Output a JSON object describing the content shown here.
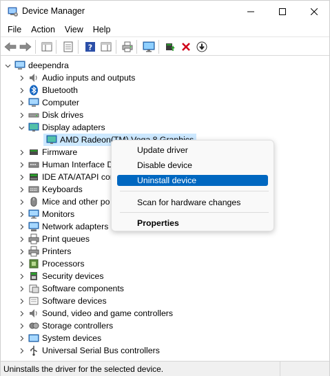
{
  "window": {
    "title": "Device Manager"
  },
  "menu": [
    "File",
    "Action",
    "View",
    "Help"
  ],
  "tree": {
    "root": "deependra",
    "items": [
      "Audio inputs and outputs",
      "Bluetooth",
      "Computer",
      "Disk drives",
      "Display adapters",
      "AMD Radeon(TM) Vega 8 Graphics",
      "Firmware",
      "Human Interface D",
      "IDE ATA/ATAPI cor",
      "Keyboards",
      "Mice and other po",
      "Monitors",
      "Network adapters",
      "Print queues",
      "Printers",
      "Processors",
      "Security devices",
      "Software components",
      "Software devices",
      "Sound, video and game controllers",
      "Storage controllers",
      "System devices",
      "Universal Serial Bus controllers"
    ]
  },
  "context_menu": {
    "items": [
      "Update driver",
      "Disable device",
      "Uninstall device",
      "Scan for hardware changes",
      "Properties"
    ],
    "highlighted": "Uninstall device"
  },
  "status": "Uninstalls the driver for the selected device.",
  "colors": {
    "highlight": "#0067c0",
    "selection": "#cce8ff",
    "delete_x": "#d0021b"
  }
}
